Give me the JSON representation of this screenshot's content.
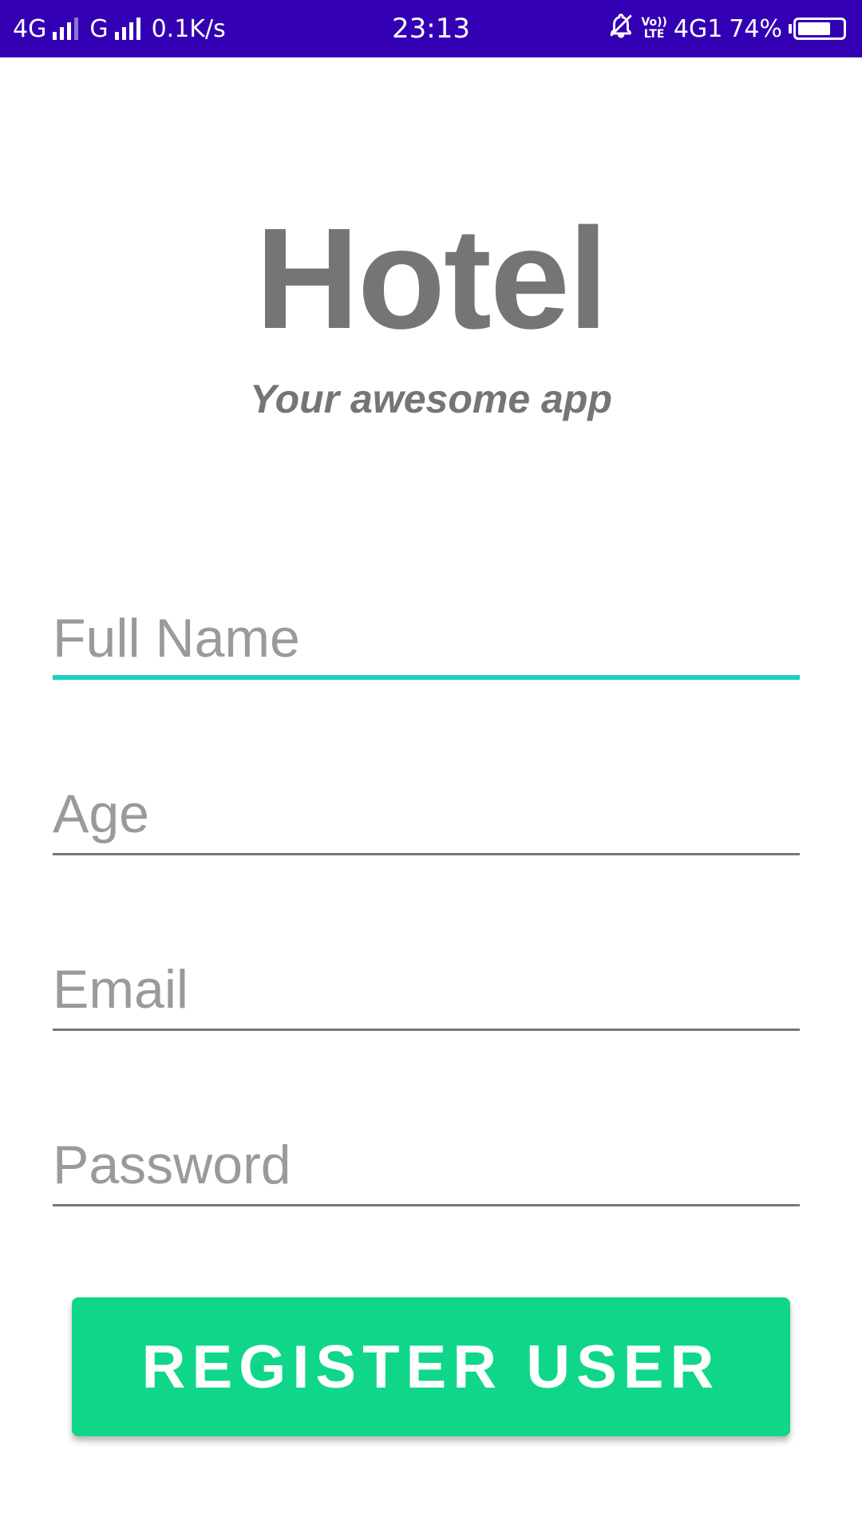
{
  "colors": {
    "status_bar_bg": "#3300b3",
    "title_text": "#757575",
    "focused_underline": "#1ad0c0",
    "default_underline": "#777777",
    "button_bg": "#10d68a",
    "button_text": "#ffffff"
  },
  "status_bar": {
    "net1": "4G",
    "net2": "G",
    "speed": "0.1K/s",
    "clock": "23:13",
    "mute_icon": "bell-off-icon",
    "volte_top": "Vo))",
    "volte_bottom": "LTE",
    "net3": "4G1",
    "battery_percent": "74%",
    "battery_level": 0.74
  },
  "header": {
    "title": "Hotel",
    "subtitle": "Your awesome app"
  },
  "form": {
    "full_name": {
      "placeholder": "Full Name",
      "value": ""
    },
    "age": {
      "placeholder": "Age",
      "value": ""
    },
    "email": {
      "placeholder": "Email",
      "value": ""
    },
    "password": {
      "placeholder": "Password",
      "value": ""
    }
  },
  "actions": {
    "register_label": "REGISTER USER"
  }
}
